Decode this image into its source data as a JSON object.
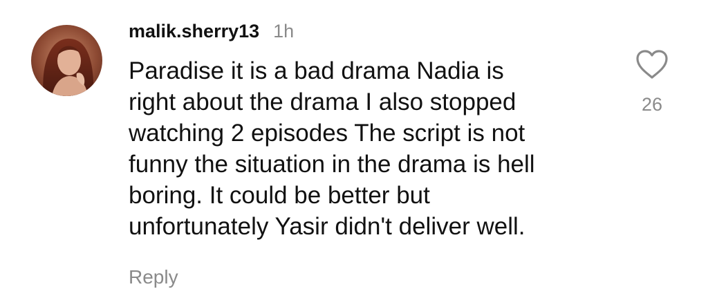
{
  "comment": {
    "username": "malik.sherry13",
    "time": "1h",
    "text_lines": [
      "Paradise it is a bad drama Nadia is",
      "right about the drama I also stopped",
      "watching 2 episodes The script is not",
      "funny the situation in the drama is hell",
      "boring. It could be better but",
      "unfortunately Yasir didn't deliver well."
    ],
    "reply_label": "Reply",
    "like_count": "26",
    "like_icon": "heart-outline-icon",
    "avatar_icon": "user-avatar"
  },
  "colors": {
    "text": "#111111",
    "secondary_text": "#8a8a8a",
    "background": "#ffffff"
  }
}
